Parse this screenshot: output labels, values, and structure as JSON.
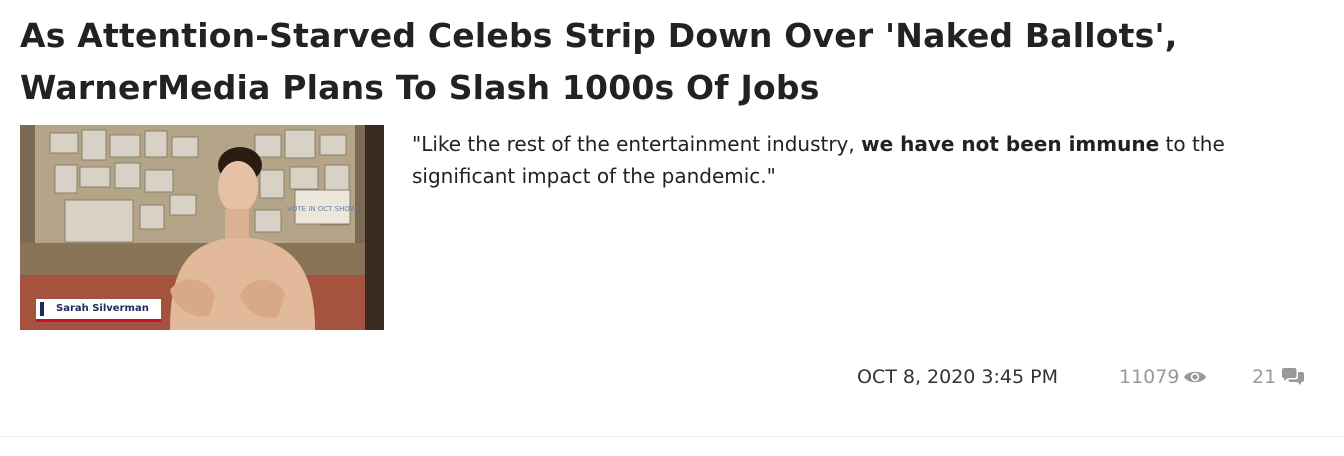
{
  "article": {
    "headline": "As Attention-Starved Celebs Strip Down Over 'Naked Ballots', WarnerMedia Plans To Slash 1000s Of Jobs",
    "image": {
      "name_tag": "Sarah Silverman",
      "wall_sign": "VOTE IN OCT SHOW"
    },
    "excerpt": {
      "before": "\"Like the rest of the entertainment industry, ",
      "bold": "we have not been immune",
      "after": " to the significant impact of the pandemic.\""
    },
    "meta": {
      "date": "OCT 8, 2020 3:45 PM",
      "views": "11079",
      "views_icon": "eye-icon",
      "comments": "21",
      "comments_icon": "comments-icon"
    }
  },
  "colors": {
    "headline": "#222222",
    "meta_muted": "#999999",
    "tag_blue": "#1d2a5a",
    "tag_red": "#c8102e"
  }
}
